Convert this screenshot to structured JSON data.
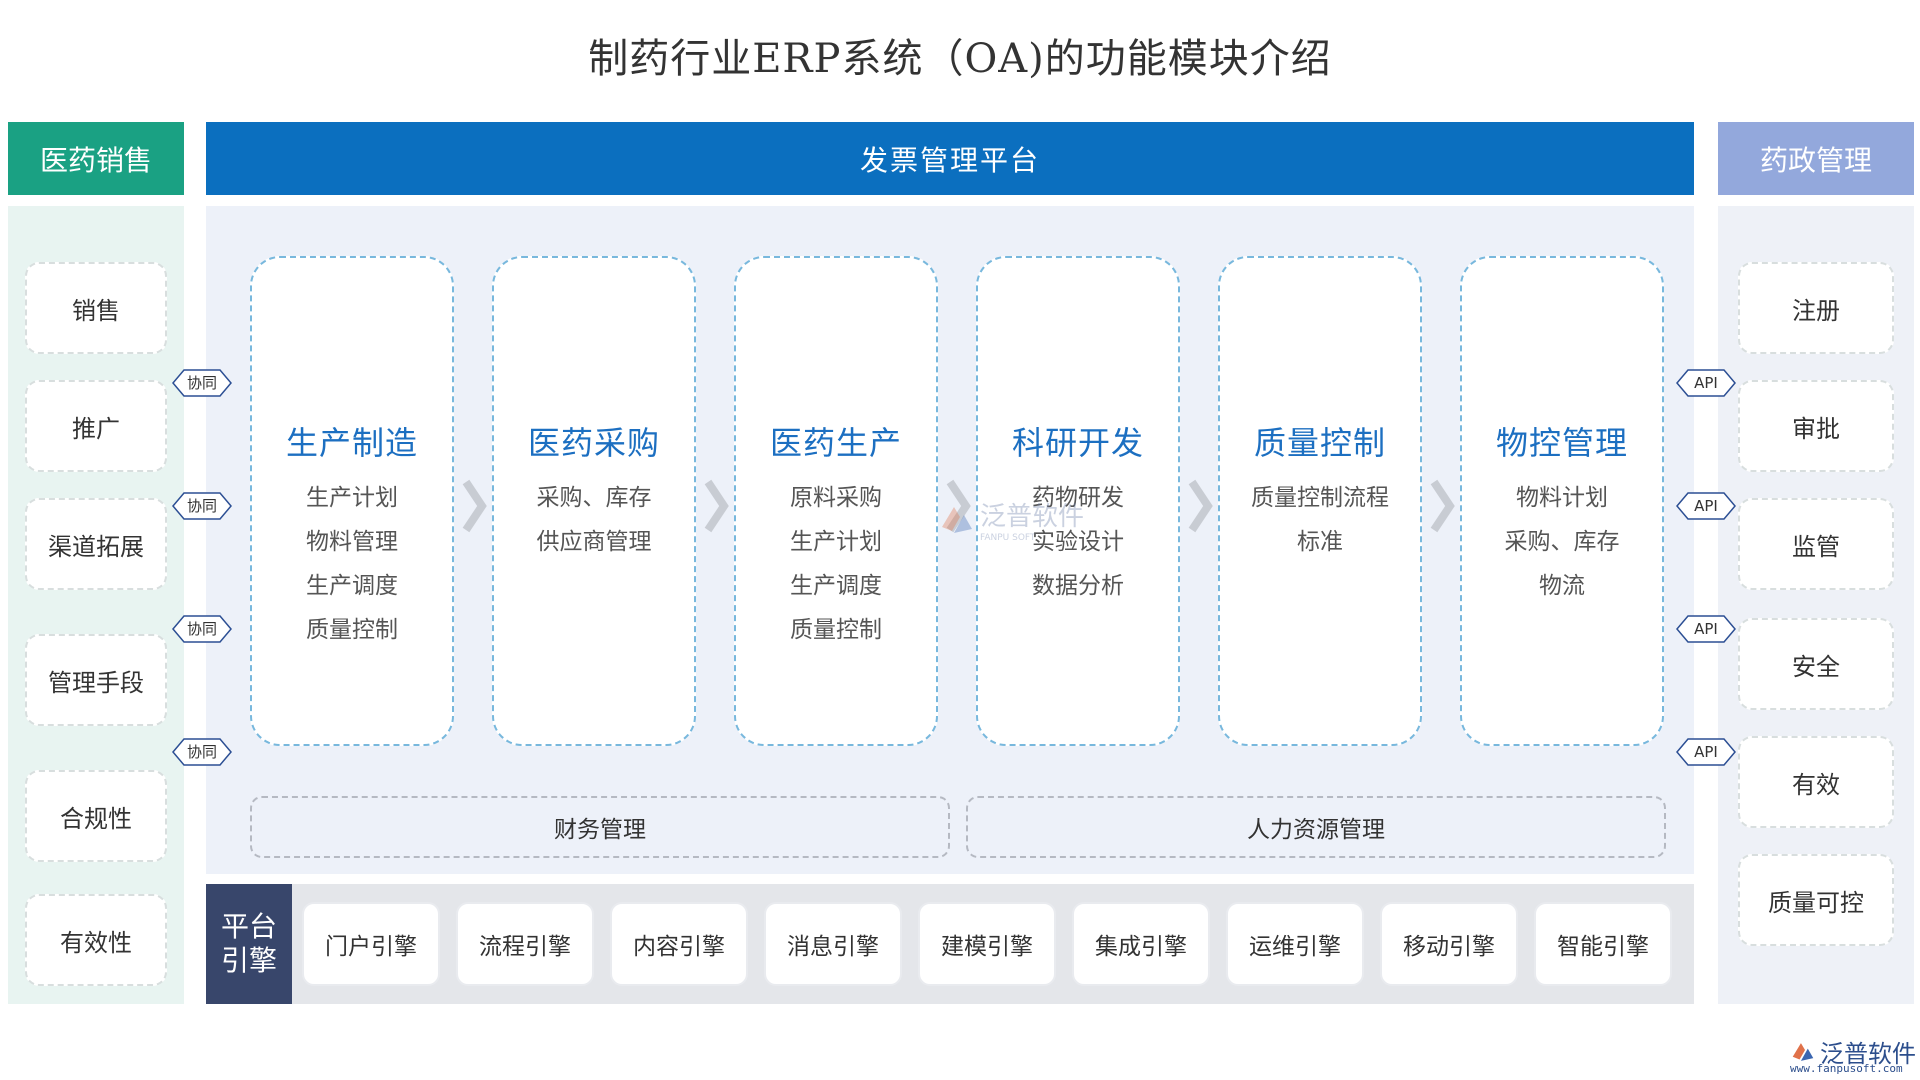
{
  "title": "制药行业ERP系统（OA)的功能模块介绍",
  "left": {
    "header": "医药销售",
    "items": [
      "销售",
      "推广",
      "渠道拓展",
      "管理手段",
      "合规性",
      "有效性"
    ]
  },
  "right": {
    "header": "药政管理",
    "items": [
      "注册",
      "审批",
      "监管",
      "安全",
      "有效",
      "质量可控"
    ]
  },
  "platform_bar": "发票管理平台",
  "modules": [
    {
      "title": "生产制造",
      "items": [
        "生产计划",
        "物料管理",
        "生产调度",
        "质量控制"
      ]
    },
    {
      "title": "医药采购",
      "items": [
        "采购、库存",
        "供应商管理"
      ]
    },
    {
      "title": "医药生产",
      "items": [
        "原料采购",
        "生产计划",
        "生产调度",
        "质量控制"
      ]
    },
    {
      "title": "科研开发",
      "items": [
        "药物研发",
        "实验设计",
        "数据分析"
      ]
    },
    {
      "title": "质量控制",
      "items": [
        "质量控制流程",
        "标准"
      ]
    },
    {
      "title": "物控管理",
      "items": [
        "物料计划",
        "采购、库存",
        "物流"
      ]
    }
  ],
  "bottom": {
    "finance": "财务管理",
    "hr": "人力资源管理"
  },
  "engines": {
    "label": "平台引擎",
    "items": [
      "门户引擎",
      "流程引擎",
      "内容引擎",
      "消息引擎",
      "建模引擎",
      "集成引擎",
      "运维引擎",
      "移动引擎",
      "智能引擎"
    ]
  },
  "connectors": {
    "left": [
      "协同",
      "协同",
      "协同",
      "协同"
    ],
    "right": [
      "API",
      "API",
      "API",
      "API"
    ]
  },
  "watermark": {
    "text": "泛普软件",
    "sub": "FANPU SOFT"
  },
  "logo": {
    "text": "泛普软件",
    "url": "www.fanpusoft.com"
  },
  "colors": {
    "left_header": "#1aa183",
    "right_header": "#93a8dc",
    "platform_bar": "#0b6fbf",
    "module_title": "#1c6fc1",
    "engine_label": "#38466b"
  }
}
